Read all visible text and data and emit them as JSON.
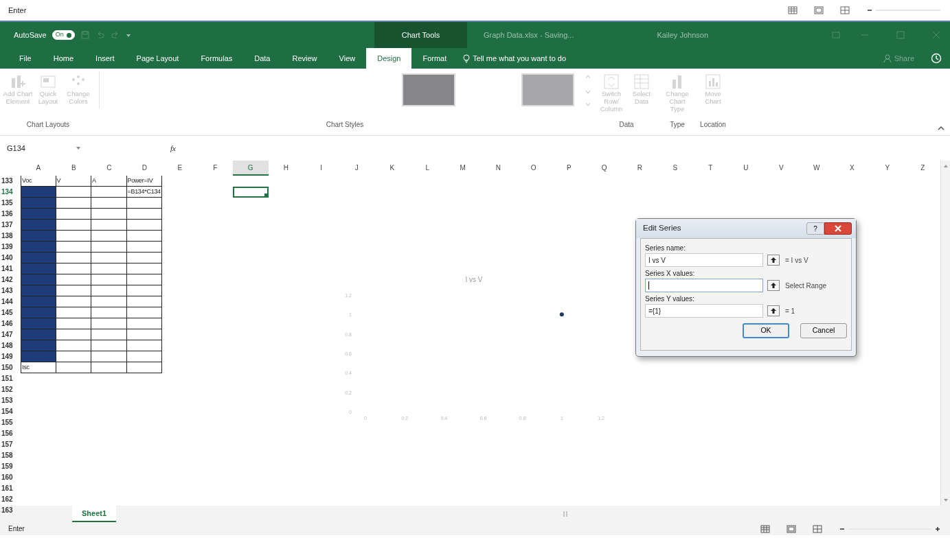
{
  "top_strip": {
    "status": "Enter"
  },
  "title_bar": {
    "autosave": {
      "label": "AutoSave",
      "state_text": "On",
      "on": true
    },
    "context_label": "Chart Tools",
    "document": "Graph Data.xlsx - Saving...",
    "user": "Kailey Johnson"
  },
  "tabs": [
    {
      "label": "File",
      "selected": false
    },
    {
      "label": "Home",
      "selected": false
    },
    {
      "label": "Insert",
      "selected": false
    },
    {
      "label": "Page Layout",
      "selected": false
    },
    {
      "label": "Formulas",
      "selected": false
    },
    {
      "label": "Data",
      "selected": false
    },
    {
      "label": "Review",
      "selected": false
    },
    {
      "label": "View",
      "selected": false
    },
    {
      "label": "Design",
      "selected": true
    },
    {
      "label": "Format",
      "selected": false
    }
  ],
  "tell_me": "Tell me what you want to do",
  "share": "Share",
  "ribbon": [
    {
      "label": "Chart Layouts",
      "kind": "buttons",
      "buttons": [
        {
          "label": "Add Chart Element",
          "disabled": true
        },
        {
          "label": "Quick Layout",
          "disabled": true
        },
        {
          "label": "Change Colors",
          "disabled": true
        }
      ]
    },
    {
      "label": "Chart Styles",
      "kind": "gallery",
      "thumbnails": [
        {
          "selected": true
        },
        {
          "selected": false
        }
      ]
    },
    {
      "label": "Data",
      "kind": "buttons",
      "buttons": [
        {
          "label": "Switch Row/ Column",
          "disabled": true
        },
        {
          "label": "Select Data",
          "disabled": true
        }
      ]
    },
    {
      "label": "Type",
      "kind": "buttons",
      "buttons": [
        {
          "label": "Change Chart Type",
          "disabled": true
        }
      ]
    },
    {
      "label": "Location",
      "kind": "buttons",
      "buttons": [
        {
          "label": "Move Chart",
          "disabled": true
        }
      ]
    }
  ],
  "formula_bar": {
    "name_box": "G134",
    "fx": "fx"
  },
  "sheet": {
    "columns": [
      {
        "label": "A",
        "selected": false
      },
      {
        "label": "B",
        "selected": false
      },
      {
        "label": "C",
        "selected": false
      },
      {
        "label": "D",
        "selected": false
      },
      {
        "label": "E",
        "selected": false
      },
      {
        "label": "F",
        "selected": false
      },
      {
        "label": "G",
        "selected": true
      },
      {
        "label": "H",
        "selected": false
      },
      {
        "label": "I",
        "selected": false
      },
      {
        "label": "J",
        "selected": false
      },
      {
        "label": "K",
        "selected": false
      },
      {
        "label": "L",
        "selected": false
      },
      {
        "label": "M",
        "selected": false
      },
      {
        "label": "N",
        "selected": false
      },
      {
        "label": "O",
        "selected": false
      },
      {
        "label": "P",
        "selected": false
      },
      {
        "label": "Q",
        "selected": false
      },
      {
        "label": "R",
        "selected": false
      },
      {
        "label": "S",
        "selected": false
      },
      {
        "label": "T",
        "selected": false
      },
      {
        "label": "U",
        "selected": false
      },
      {
        "label": "V",
        "selected": false
      },
      {
        "label": "W",
        "selected": false
      },
      {
        "label": "X",
        "selected": false
      },
      {
        "label": "Y",
        "selected": false
      },
      {
        "label": "Z",
        "selected": false
      }
    ],
    "rows": [
      {
        "number": "133",
        "selected": false,
        "cells": [
          {
            "text": "Voc",
            "kind": "bordered",
            "selected": false,
            "active": false
          },
          {
            "text": "V",
            "kind": "bordered",
            "selected": false,
            "active": false
          },
          {
            "text": "A",
            "kind": "bordered",
            "selected": false,
            "active": false
          },
          {
            "text": "Power=IV",
            "kind": "bordered",
            "selected": false,
            "active": false
          }
        ]
      },
      {
        "number": "134",
        "selected": true,
        "cells": [
          {
            "kind": "bordered",
            "selected": true,
            "active": false
          },
          {
            "kind": "bordered",
            "selected": false,
            "active": false
          },
          {
            "kind": "bordered",
            "selected": false,
            "active": false
          },
          {
            "text": "=B134*C134",
            "kind": "bordered",
            "selected": false,
            "active": false
          },
          {
            "kind": "plain",
            "selected": false,
            "active": false
          },
          {
            "kind": "plain",
            "selected": false,
            "active": false
          },
          {
            "kind": "plain",
            "selected": true,
            "active": true
          }
        ]
      },
      {
        "number": "135",
        "selected": false,
        "cells": [
          {
            "kind": "bordered",
            "selected": true,
            "active": false
          },
          {
            "kind": "bordered",
            "selected": false,
            "active": false
          },
          {
            "kind": "bordered",
            "selected": false,
            "active": false
          },
          {
            "kind": "bordered",
            "selected": false,
            "active": false
          }
        ]
      },
      {
        "number": "136",
        "selected": false,
        "cells": [
          {
            "kind": "bordered",
            "selected": true,
            "active": false
          },
          {
            "kind": "bordered",
            "selected": false,
            "active": false
          },
          {
            "kind": "bordered",
            "selected": false,
            "active": false
          },
          {
            "kind": "bordered",
            "selected": false,
            "active": false
          }
        ]
      },
      {
        "number": "137",
        "selected": false,
        "cells": [
          {
            "kind": "bordered",
            "selected": true,
            "active": false
          },
          {
            "kind": "bordered",
            "selected": false,
            "active": false
          },
          {
            "kind": "bordered",
            "selected": false,
            "active": false
          },
          {
            "kind": "bordered",
            "selected": false,
            "active": false
          }
        ]
      },
      {
        "number": "138",
        "selected": false,
        "cells": [
          {
            "kind": "bordered",
            "selected": true,
            "active": false
          },
          {
            "kind": "bordered",
            "selected": false,
            "active": false
          },
          {
            "kind": "bordered",
            "selected": false,
            "active": false
          },
          {
            "kind": "bordered",
            "selected": false,
            "active": false
          }
        ]
      },
      {
        "number": "139",
        "selected": false,
        "cells": [
          {
            "kind": "bordered",
            "selected": true,
            "active": false
          },
          {
            "kind": "bordered",
            "selected": false,
            "active": false
          },
          {
            "kind": "bordered",
            "selected": false,
            "active": false
          },
          {
            "kind": "bordered",
            "selected": false,
            "active": false
          }
        ]
      },
      {
        "number": "140",
        "selected": false,
        "cells": [
          {
            "kind": "bordered",
            "selected": true,
            "active": false
          },
          {
            "kind": "bordered",
            "selected": false,
            "active": false
          },
          {
            "kind": "bordered",
            "selected": false,
            "active": false
          },
          {
            "kind": "bordered",
            "selected": false,
            "active": false
          }
        ]
      },
      {
        "number": "141",
        "selected": false,
        "cells": [
          {
            "kind": "bordered",
            "selected": true,
            "active": false
          },
          {
            "kind": "bordered",
            "selected": false,
            "active": false
          },
          {
            "kind": "bordered",
            "selected": false,
            "active": false
          },
          {
            "kind": "bordered",
            "selected": false,
            "active": false
          }
        ]
      },
      {
        "number": "142",
        "selected": false,
        "cells": [
          {
            "kind": "bordered",
            "selected": true,
            "active": false
          },
          {
            "kind": "bordered",
            "selected": false,
            "active": false
          },
          {
            "kind": "bordered",
            "selected": false,
            "active": false
          },
          {
            "kind": "bordered",
            "selected": false,
            "active": false
          }
        ]
      },
      {
        "number": "143",
        "selected": false,
        "cells": [
          {
            "kind": "bordered",
            "selected": true,
            "active": false
          },
          {
            "kind": "bordered",
            "selected": false,
            "active": false
          },
          {
            "kind": "bordered",
            "selected": false,
            "active": false
          },
          {
            "kind": "bordered",
            "selected": false,
            "active": false
          }
        ]
      },
      {
        "number": "144",
        "selected": false,
        "cells": [
          {
            "kind": "bordered",
            "selected": true,
            "active": false
          },
          {
            "kind": "bordered",
            "selected": false,
            "active": false
          },
          {
            "kind": "bordered",
            "selected": false,
            "active": false
          },
          {
            "kind": "bordered",
            "selected": false,
            "active": false
          }
        ]
      },
      {
        "number": "145",
        "selected": false,
        "cells": [
          {
            "kind": "bordered",
            "selected": true,
            "active": false
          },
          {
            "kind": "bordered",
            "selected": false,
            "active": false
          },
          {
            "kind": "bordered",
            "selected": false,
            "active": false
          },
          {
            "kind": "bordered",
            "selected": false,
            "active": false
          }
        ]
      },
      {
        "number": "146",
        "selected": false,
        "cells": [
          {
            "kind": "bordered",
            "selected": true,
            "active": false
          },
          {
            "kind": "bordered",
            "selected": false,
            "active": false
          },
          {
            "kind": "bordered",
            "selected": false,
            "active": false
          },
          {
            "kind": "bordered",
            "selected": false,
            "active": false
          }
        ]
      },
      {
        "number": "147",
        "selected": false,
        "cells": [
          {
            "kind": "bordered",
            "selected": true,
            "active": false
          },
          {
            "kind": "bordered",
            "selected": false,
            "active": false
          },
          {
            "kind": "bordered",
            "selected": false,
            "active": false
          },
          {
            "kind": "bordered",
            "selected": false,
            "active": false
          }
        ]
      },
      {
        "number": "148",
        "selected": false,
        "cells": [
          {
            "kind": "bordered",
            "selected": true,
            "active": false
          },
          {
            "kind": "bordered",
            "selected": false,
            "active": false
          },
          {
            "kind": "bordered",
            "selected": false,
            "active": false
          },
          {
            "kind": "bordered",
            "selected": false,
            "active": false
          }
        ]
      },
      {
        "number": "149",
        "selected": false,
        "cells": [
          {
            "kind": "bordered",
            "selected": true,
            "active": false
          },
          {
            "kind": "bordered",
            "selected": false,
            "active": false
          },
          {
            "kind": "bordered",
            "selected": false,
            "active": false
          },
          {
            "kind": "bordered",
            "selected": false,
            "active": false
          }
        ]
      },
      {
        "number": "150",
        "selected": false,
        "cells": [
          {
            "text": "Isc",
            "kind": "bordered",
            "selected": false,
            "active": false
          },
          {
            "kind": "bordered",
            "selected": false,
            "active": false
          },
          {
            "kind": "bordered",
            "selected": false,
            "active": false
          },
          {
            "kind": "bordered",
            "selected": false,
            "active": false
          }
        ]
      },
      {
        "number": "151",
        "selected": false
      },
      {
        "number": "152",
        "selected": false
      },
      {
        "number": "153",
        "selected": false
      },
      {
        "number": "154",
        "selected": false
      },
      {
        "number": "155",
        "selected": false
      },
      {
        "number": "156",
        "selected": false
      },
      {
        "number": "157",
        "selected": false
      },
      {
        "number": "158",
        "selected": false
      },
      {
        "number": "159",
        "selected": false
      },
      {
        "number": "160",
        "selected": false
      },
      {
        "number": "161",
        "selected": false
      },
      {
        "number": "162",
        "selected": false
      },
      {
        "number": "163",
        "selected": false
      }
    ]
  },
  "chart": {
    "chart_data": {
      "type": "scatter",
      "title": "I vs V",
      "x": [
        1
      ],
      "series": [
        {
          "color": "#1f3864",
          "values": [
            1
          ]
        }
      ],
      "xlim": [
        0,
        1.2
      ],
      "ylim": [
        0,
        1.2
      ],
      "xticks": [
        0,
        0.2,
        0.4,
        0.6,
        0.8,
        1,
        1.2
      ],
      "yticks": [
        0,
        0.2,
        0.4,
        0.6,
        0.8,
        1,
        1.2
      ]
    }
  },
  "dialog": {
    "title": "Edit Series",
    "help": "?",
    "fields": [
      {
        "label": "Series name:",
        "value": "I vs V",
        "focused": false,
        "preview": "= I vs V"
      },
      {
        "label": "Series X values:",
        "focused": true,
        "preview": "Select Range"
      },
      {
        "label": "Series Y values:",
        "value": "={1}",
        "focused": false,
        "preview": "= 1"
      }
    ],
    "buttons": [
      {
        "label": "OK",
        "default": true
      },
      {
        "label": "Cancel",
        "default": false
      }
    ]
  },
  "sheet_tabs": [
    {
      "label": "Sheet1",
      "selected": true
    }
  ],
  "status_bar": {
    "status": "Enter"
  }
}
